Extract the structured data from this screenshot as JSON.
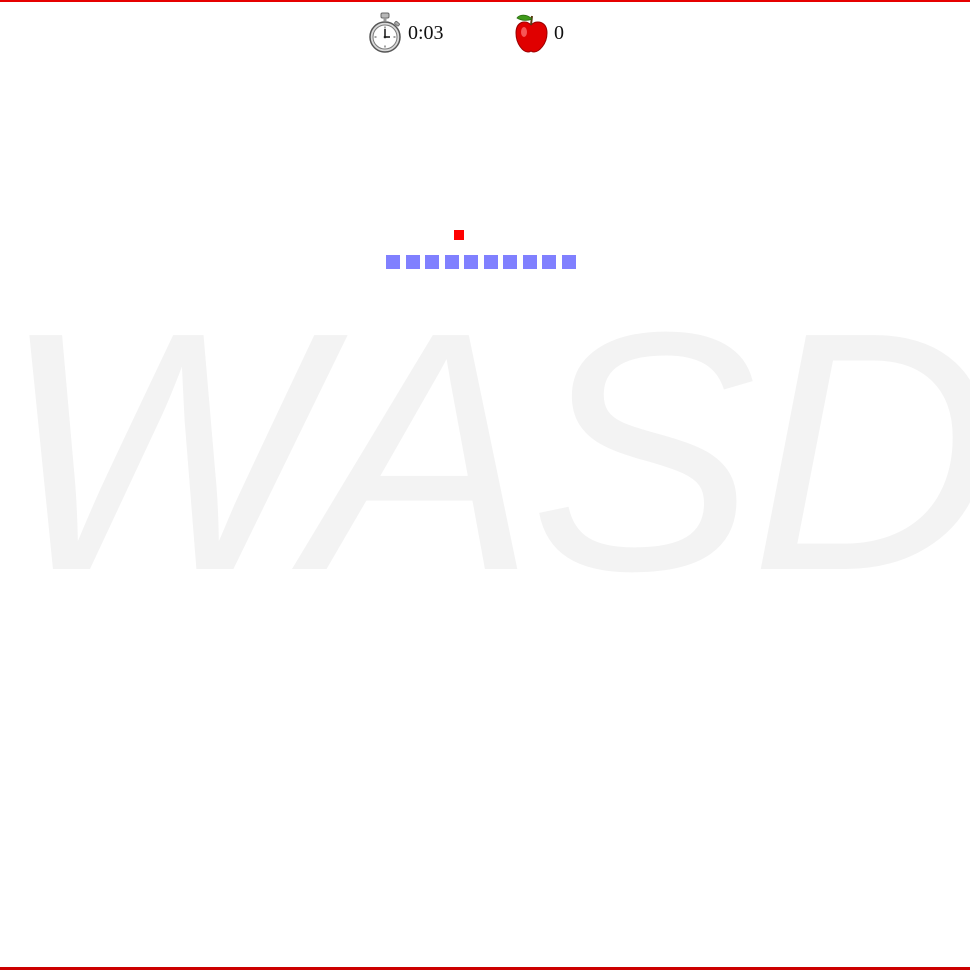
{
  "hud": {
    "timer_icon": "stopwatch-icon",
    "timer": "0:03",
    "score_icon": "apple-icon",
    "score": "0"
  },
  "watermark": {
    "text": "WASD"
  },
  "colors": {
    "frame_border": "#e60000",
    "snake": "#8080ff",
    "food": "#ff0000",
    "watermark": "#f3f3f3",
    "background": "#ffffff"
  },
  "game": {
    "snake_length": 10,
    "direction": "right",
    "snake": [
      {
        "col": 0,
        "row": 1
      },
      {
        "col": 1,
        "row": 1
      },
      {
        "col": 2,
        "row": 1
      },
      {
        "col": 3,
        "row": 1
      },
      {
        "col": 4,
        "row": 1
      },
      {
        "col": 5,
        "row": 1
      },
      {
        "col": 6,
        "row": 1
      },
      {
        "col": 7,
        "row": 1
      },
      {
        "col": 8,
        "row": 1
      },
      {
        "col": 9,
        "row": 1
      }
    ],
    "food": {
      "col": 3.5,
      "row": 0
    }
  }
}
